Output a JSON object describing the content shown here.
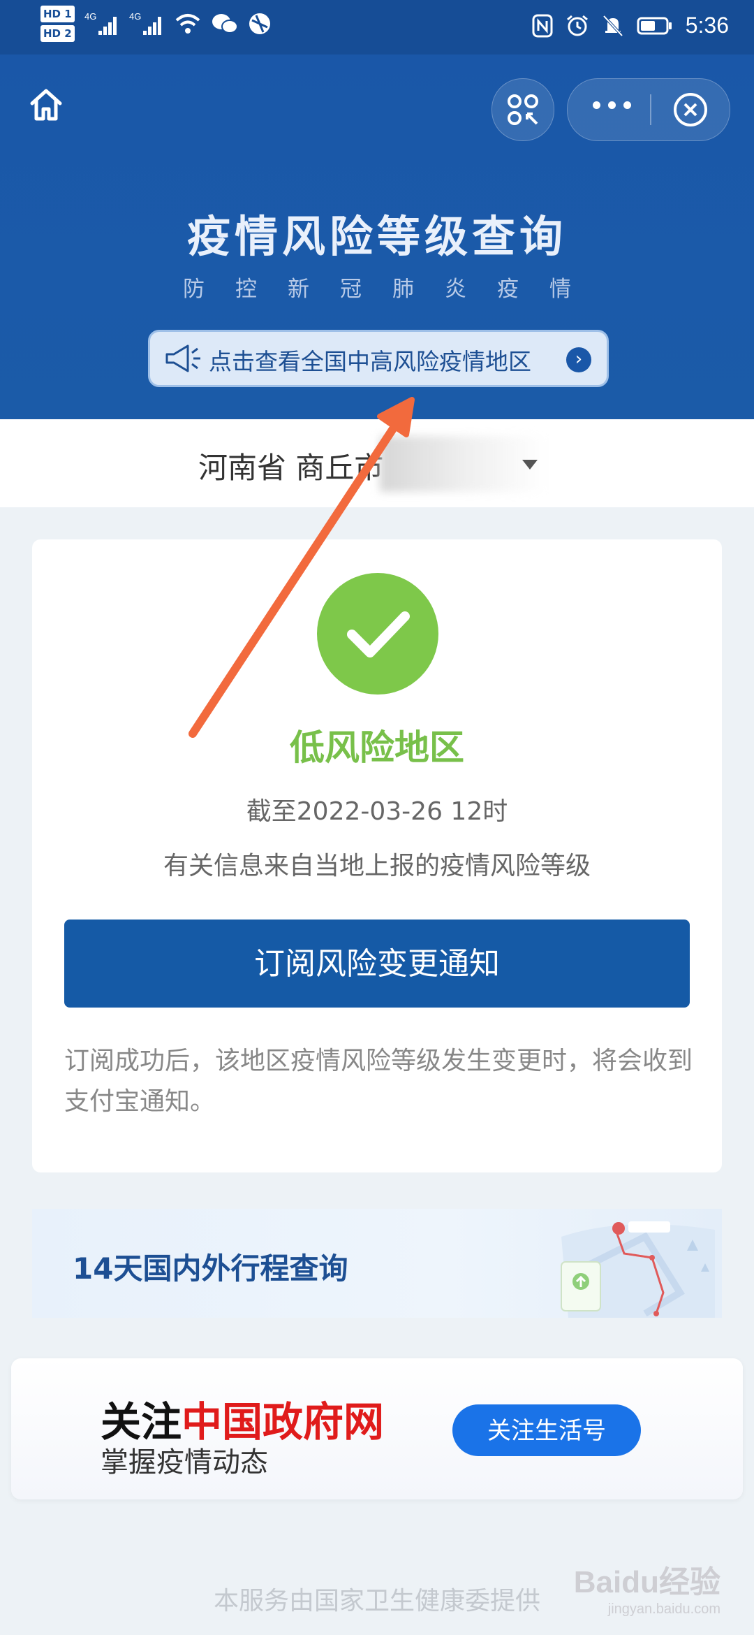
{
  "status_bar": {
    "left": [
      "HD 1",
      "HD 2"
    ],
    "signal1": "4G",
    "signal2": "4G",
    "time": "5:36"
  },
  "header": {
    "title": "疫情风险等级查询",
    "subtitle": "防控新冠肺炎疫情",
    "notice": "点击查看全国中高风险疫情地区"
  },
  "location": {
    "text": "河南省 商丘市"
  },
  "result": {
    "risk_level": "低风险地区",
    "as_of": "截至2022-03-26 12时",
    "source": "有关信息来自当地上报的疫情风险等级",
    "subscribe_label": "订阅风险变更通知",
    "subscribe_note": "订阅成功后，该地区疫情风险等级发生变更时，将会收到支付宝通知。"
  },
  "trip": {
    "label": "14天国内外行程查询"
  },
  "follow": {
    "prefix": "关注",
    "highlight": "中国政府网",
    "line2": "掌握疫情动态",
    "button": "关注生活号"
  },
  "footer": {
    "text": "本服务由国家卫生健康委提供"
  },
  "watermark": {
    "brand": "Baidu经验",
    "url": "jingyan.baidu.com"
  },
  "colors": {
    "header_bg": "#1a57a8",
    "low_risk_green": "#7ec84a",
    "primary_button": "#155aa6",
    "follow_red": "#e01b1b",
    "annotation_arrow": "#f26a3d"
  }
}
